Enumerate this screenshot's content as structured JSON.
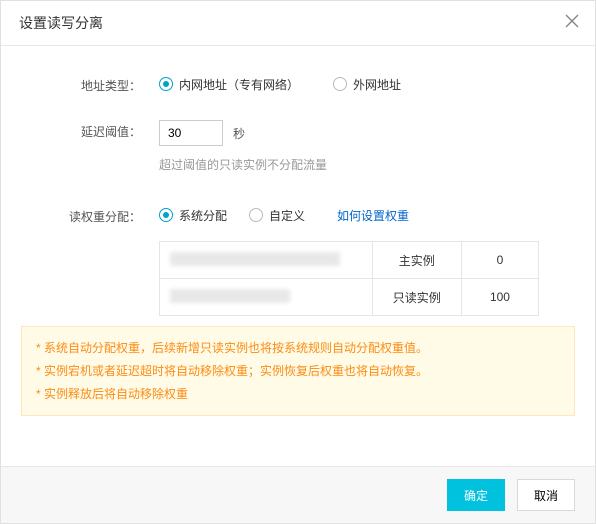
{
  "dialog": {
    "title": "设置读写分离",
    "close_label": "×"
  },
  "form": {
    "addr_type": {
      "label": "地址类型：",
      "options": [
        {
          "label": "内网地址（专有网络）",
          "checked": true
        },
        {
          "label": "外网地址",
          "checked": false
        }
      ]
    },
    "threshold": {
      "label": "延迟阈值：",
      "value": "30",
      "unit": "秒",
      "hint": "超过阈值的只读实例不分配流量"
    },
    "weight": {
      "label": "读权重分配：",
      "options": [
        {
          "label": "系统分配",
          "checked": true
        },
        {
          "label": "自定义",
          "checked": false
        }
      ],
      "help_link": "如何设置权重",
      "rows": [
        {
          "id_masked": true,
          "type": "主实例",
          "value": "0"
        },
        {
          "id_masked": true,
          "type": "只读实例",
          "value": "100"
        }
      ]
    }
  },
  "notes": [
    "系统自动分配权重，后续新增只读实例也将按系统规则自动分配权重值。",
    "实例宕机或者延迟超时将自动移除权重；实例恢复后权重也将自动恢复。",
    "实例释放后将自动移除权重"
  ],
  "footer": {
    "ok": "确定",
    "cancel": "取消"
  }
}
